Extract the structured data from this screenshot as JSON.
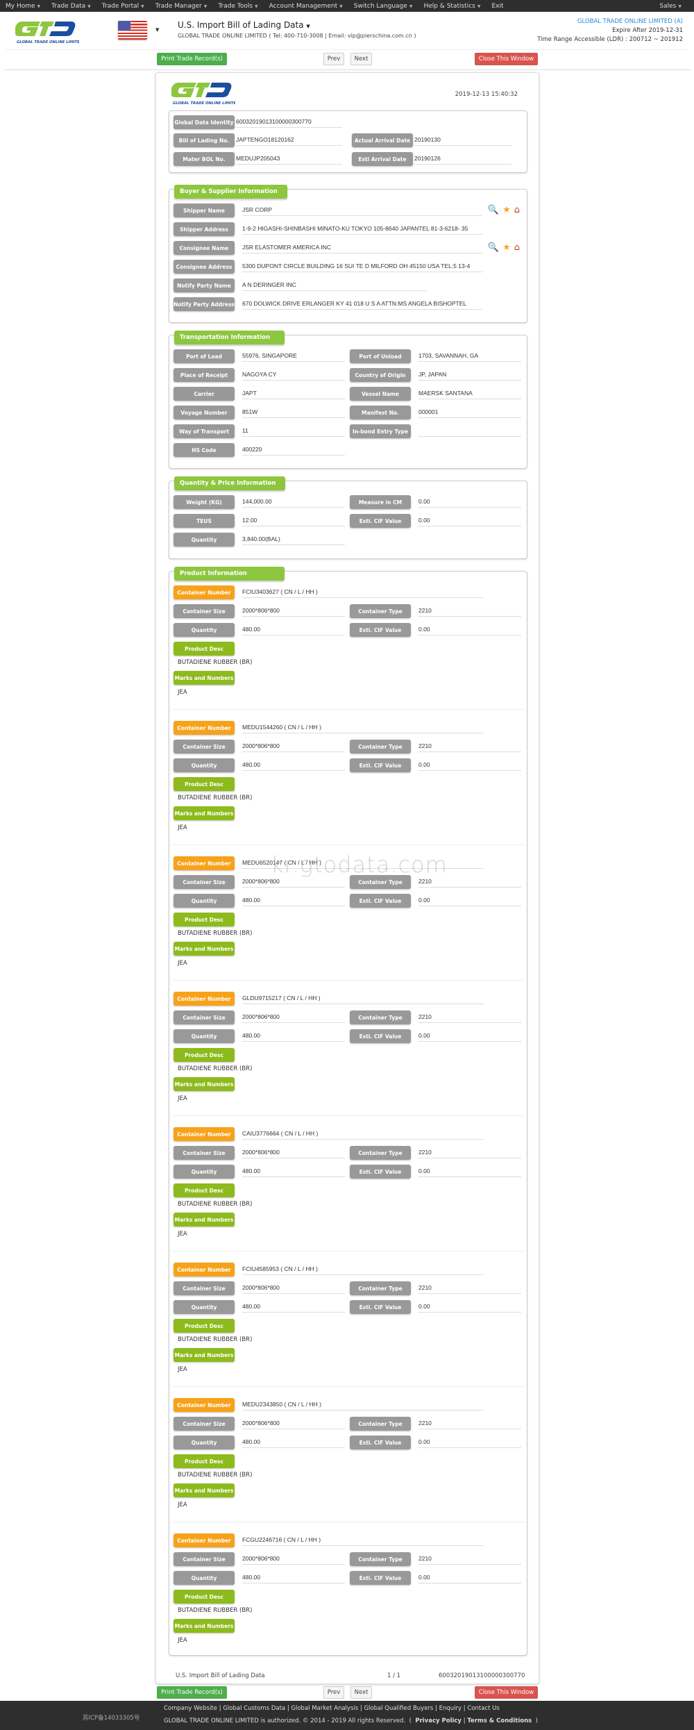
{
  "topnav": {
    "items": [
      "My Home",
      "Trade Data",
      "Trade Portal",
      "Trade Manager",
      "Trade Tools",
      "Account Management",
      "Switch Language",
      "Help & Statistics",
      "Exit"
    ],
    "right": "Sales"
  },
  "header": {
    "logo_text": "GTO",
    "logo_sub": "GLOBAL TRADE ONLINE LIMITED",
    "title": "U.S. Import Bill of Lading Data",
    "contact": "GLOBAL TRADE ONLINE LIMITED ( Tel: 400-710-3008 | Email: vip@pierschina.com.cn )",
    "company": "GLOBAL TRADE ONLINE LIMITED (A)",
    "expire": "Expire After 2019-12-31",
    "time_range": "Time Range Accessible (LDR) : 200712 ~ 201912"
  },
  "buttons": {
    "print": "Print Trade Record(s)",
    "prev": "Prev",
    "next": "Next",
    "close": "Close This Window"
  },
  "record": {
    "timestamp": "2019-12-13 15:40:32",
    "global_data_identity_label": "Global Data Identity",
    "global_data_identity": "60032019013100000300770",
    "bol_label": "Bill of Lading No.",
    "bol": "JAPTENGO18120162",
    "actual_arrival_label": "Actual Arrival Date",
    "actual_arrival": "20190130",
    "master_bol_label": "Mater BOL No.",
    "master_bol": "MEDUJP205043",
    "esti_arrival_label": "Esti Arrival Date",
    "esti_arrival": "20190126"
  },
  "buyer_supplier": {
    "title": "Buyer & Supplier Information",
    "rows": [
      {
        "label": "Shipper Name",
        "value": "JSR CORP",
        "icons": true
      },
      {
        "label": "Shipper Address",
        "value": " 1-9-2 HIGASHI-SHINBASHI MINATO-KU TOKYO 105-8640 JAPANTEL 81-3-6218- 35",
        "icons": false
      },
      {
        "label": "Consignee Name",
        "value": "JSR ELASTOMER AMERICA INC",
        "icons": true
      },
      {
        "label": "Consignee Address",
        "value": "5300 DUPONT CIRCLE BUILDING 16 SUI TE D MILFORD OH 45150 USA TEL:5 13-4",
        "icons": false
      },
      {
        "label": "Notify Party Name",
        "value": "A N DERINGER INC",
        "icons": false
      },
      {
        "label": "Notify Party Address",
        "value": "670 DOLWICK DRIVE ERLANGER KY 41 018 U S A ATTN:MS ANGELA BISHOPTEL",
        "icons": false
      }
    ]
  },
  "transportation": {
    "title": "Transportation Information",
    "rows": [
      [
        {
          "label": "Port of Load",
          "value": "55976, SINGAPORE"
        },
        {
          "label": "Port of Unload",
          "value": "1703, SAVANNAH, GA"
        }
      ],
      [
        {
          "label": "Place of Receipt",
          "value": "NAGOYA CY"
        },
        {
          "label": "Country of Origin",
          "value": "JP, JAPAN"
        }
      ],
      [
        {
          "label": "Carrier",
          "value": "JAPT"
        },
        {
          "label": "Vessel Name",
          "value": "MAERSK SANTANA"
        }
      ],
      [
        {
          "label": "Voyage Number",
          "value": "851W"
        },
        {
          "label": "Manifest No.",
          "value": "000001"
        }
      ],
      [
        {
          "label": "Way of Transport",
          "value": "11"
        },
        {
          "label": "In-bond Entry Type",
          "value": ""
        }
      ],
      [
        {
          "label": "HS Code",
          "value": "400220"
        }
      ]
    ]
  },
  "quantity_price": {
    "title": "Quantity & Price Information",
    "rows": [
      [
        {
          "label": "Weight (KG)",
          "value": "144,000.00"
        },
        {
          "label": "Measure in CM",
          "value": "0.00"
        }
      ],
      [
        {
          "label": "TEUS",
          "value": "12.00"
        },
        {
          "label": "Esti. CIF Value",
          "value": "0.00"
        }
      ],
      [
        {
          "label": "Quantity",
          "value": "3,840.00(BAL)"
        }
      ]
    ]
  },
  "product": {
    "title": "Product Information",
    "labels": {
      "container_number": "Container Number",
      "container_size": "Container Size",
      "container_type": "Container Type",
      "quantity": "Quantity",
      "cif": "Esti. CIF Value",
      "desc": "Product Desc",
      "marks": "Marks and Numbers"
    },
    "containers": [
      {
        "number": "FCIU3403627 ( CN / L / HH )",
        "size": "2000*806*800",
        "type": "2210",
        "quantity": "480.00",
        "cif": "0.00",
        "desc": "BUTADIENE RUBBER (BR)",
        "marks": "JEA"
      },
      {
        "number": "MEDU1544260 ( CN / L / HH )",
        "size": "2000*806*800",
        "type": "2210",
        "quantity": "480.00",
        "cif": "0.00",
        "desc": "BUTADIENE RUBBER (BR)",
        "marks": "JEA"
      },
      {
        "number": "MEDU6520147 ( CN / L / HH )",
        "size": "2000*806*800",
        "type": "2210",
        "quantity": "480.00",
        "cif": "0.00",
        "desc": "BUTADIENE RUBBER (BR)",
        "marks": "JEA"
      },
      {
        "number": "GLDU9715217 ( CN / L / HH )",
        "size": "2000*806*800",
        "type": "2210",
        "quantity": "480.00",
        "cif": "0.00",
        "desc": "BUTADIENE RUBBER (BR)",
        "marks": "JEA"
      },
      {
        "number": "CAIU3776664 ( CN / L / HH )",
        "size": "2000*806*800",
        "type": "2210",
        "quantity": "480.00",
        "cif": "0.00",
        "desc": "BUTADIENE RUBBER (BR)",
        "marks": "JEA"
      },
      {
        "number": "FCIU4585953 ( CN / L / HH )",
        "size": "2000*806*800",
        "type": "2210",
        "quantity": "480.00",
        "cif": "0.00",
        "desc": "BUTADIENE RUBBER (BR)",
        "marks": "JEA"
      },
      {
        "number": "MEDU2343850 ( CN / L / HH )",
        "size": "2000*806*800",
        "type": "2210",
        "quantity": "480.00",
        "cif": "0.00",
        "desc": "BUTADIENE RUBBER (BR)",
        "marks": "JEA"
      },
      {
        "number": "FCGU2246716 ( CN / L / HH )",
        "size": "2000*806*800",
        "type": "2210",
        "quantity": "480.00",
        "cif": "0.00",
        "desc": "BUTADIENE RUBBER (BR)",
        "marks": "JEA"
      }
    ]
  },
  "sheet_footer": {
    "left": "U.S. Import Bill of Lading Data",
    "page": "1 / 1",
    "id": "60032019013100000300770"
  },
  "watermark": "kr.gtodata.com",
  "footer": {
    "icp": "苏ICP备14033305号",
    "links": [
      "Company Website",
      "Global Customs Data",
      "Global Market Analysis",
      "Global Qualified Buyers",
      "Enquiry",
      "Contact Us"
    ],
    "copyright": "GLOBAL TRADE ONLINE LIMITED is authorized. © 2014 - 2019 All rights Reserved.",
    "privacy": "Privacy Policy",
    "terms": "Terms & Conditions"
  }
}
